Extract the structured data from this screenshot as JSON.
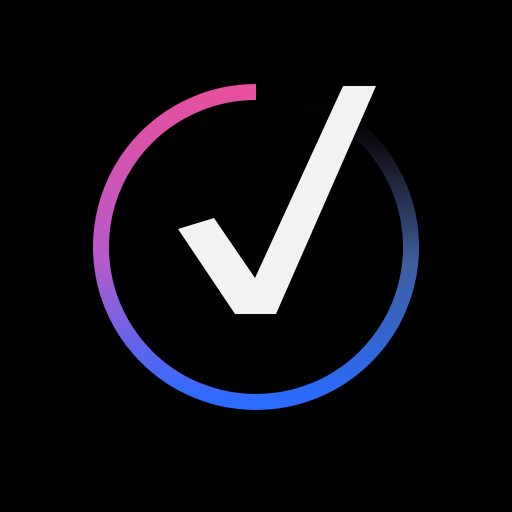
{
  "app_icon": {
    "icon": "verified-check-icon",
    "colors": {
      "background": "#000000",
      "check": "#F2F2F2",
      "ring_pink": "#E6509E",
      "ring_purple": "#9A58D8",
      "ring_blue": "#2B6BFF"
    }
  }
}
